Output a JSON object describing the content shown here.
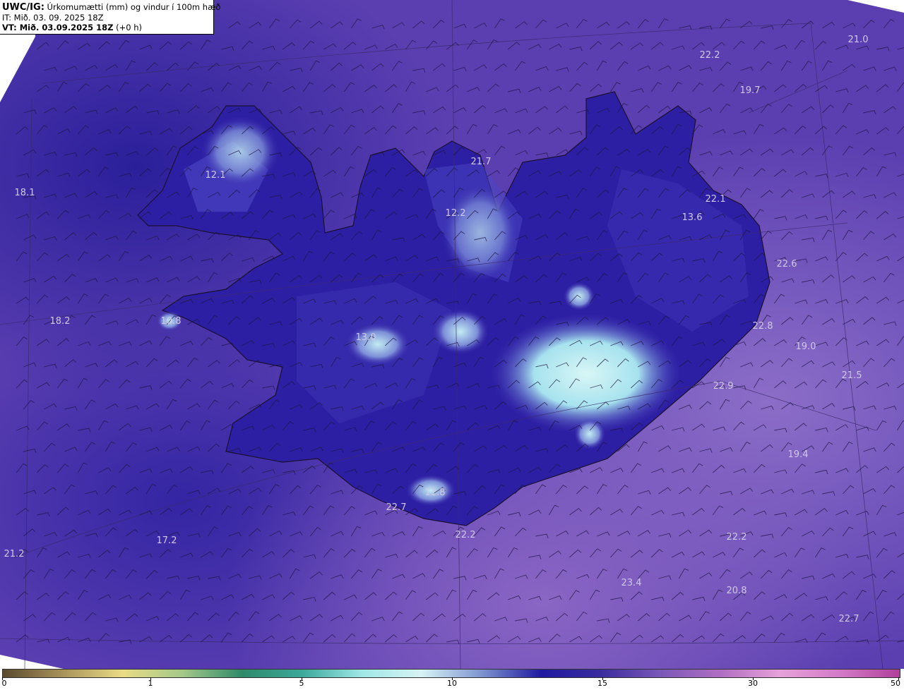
{
  "header": {
    "model_label": "UWC/IG:",
    "title": "Úrkomumætti (mm) og vindur í 100m hæð",
    "initial_time": "IT: Mið. 03. 09. 2025 18Z",
    "valid_label": "VT: Mið. 03.09.2025 18Z",
    "valid_offset": "(+0 h)"
  },
  "map_values": [
    {
      "label": "22.2",
      "pos": "east-north-sea"
    },
    {
      "label": "21.0",
      "pos": "northeast-corner"
    },
    {
      "label": "19.7",
      "pos": "northeast-sea"
    },
    {
      "label": "12.1",
      "pos": "westfjords"
    },
    {
      "label": "18.1",
      "pos": "west-sea"
    },
    {
      "label": "21.7",
      "pos": "north-peninsula"
    },
    {
      "label": "12.2",
      "pos": "north-highlands"
    },
    {
      "label": "22.1",
      "pos": "east-fjords-north"
    },
    {
      "label": "13.6",
      "pos": "east-highlands"
    },
    {
      "label": "22.6",
      "pos": "east-coast"
    },
    {
      "label": "18.2",
      "pos": "west-sea-mid"
    },
    {
      "label": "10.8",
      "pos": "snaefellsnes"
    },
    {
      "label": "13.0",
      "pos": "central-west"
    },
    {
      "label": "22.8",
      "pos": "east-sea"
    },
    {
      "label": "19.0",
      "pos": "east-sea-2"
    },
    {
      "label": "21.5",
      "pos": "east-sea-3"
    },
    {
      "label": "22.9",
      "pos": "southeast-coast"
    },
    {
      "label": "19.4",
      "pos": "southeast-sea"
    },
    {
      "label": "11.8",
      "pos": "south-glacier"
    },
    {
      "label": "22.7",
      "pos": "south-coast"
    },
    {
      "label": "22.2",
      "pos": "south-sea"
    },
    {
      "label": "17.2",
      "pos": "southwest-sea"
    },
    {
      "label": "21.2",
      "pos": "southwest-corner"
    },
    {
      "label": "22.2",
      "pos": "southeast-sea-2"
    },
    {
      "label": "23.4",
      "pos": "south-sea-2"
    },
    {
      "label": "20.8",
      "pos": "south-sea-3"
    },
    {
      "label": "22.7",
      "pos": "southeast-corner"
    }
  ],
  "colorbar": {
    "ticks": [
      "0",
      "1",
      "5",
      "10",
      "15",
      "30",
      "50"
    ],
    "colors": [
      "#5a4a2e",
      "#a8925a",
      "#e9dc86",
      "#a5c88a",
      "#2f8a6a",
      "#3aa89a",
      "#9fe7e6",
      "#d7f3f5",
      "#7f95d0",
      "#1f1aa0",
      "#3a2c9e",
      "#7a58b8",
      "#b06ec2",
      "#e6a2d8",
      "#d47ac8",
      "#b0409a"
    ]
  },
  "colors": {
    "sea": "#5a3fb0",
    "sea_light": "#7a5fc0",
    "land": "#2a1f9a",
    "land_dark": "#1a148a",
    "snow": "#c9f1f3"
  }
}
